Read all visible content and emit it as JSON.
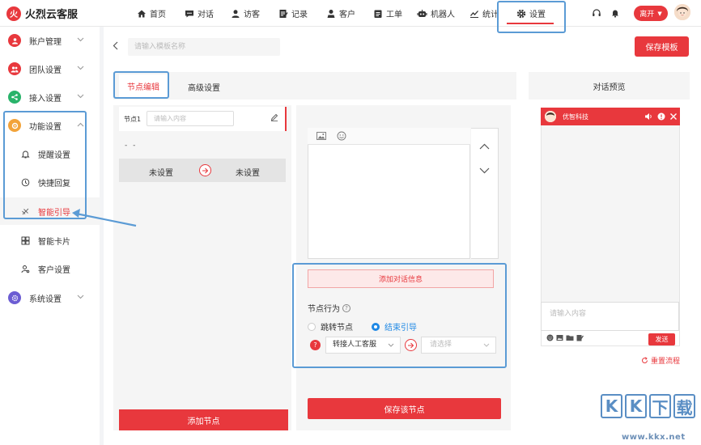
{
  "brand": {
    "logo_text": "火烈云客服",
    "accent": "#e8383d",
    "highlight": "#5b9bd5"
  },
  "topnav": {
    "items": [
      {
        "label": "首页",
        "icon": "home-icon"
      },
      {
        "label": "对话",
        "icon": "chat-icon"
      },
      {
        "label": "访客",
        "icon": "visitor-icon"
      },
      {
        "label": "记录",
        "icon": "record-icon"
      },
      {
        "label": "客户",
        "icon": "customer-icon"
      },
      {
        "label": "工单",
        "icon": "ticket-icon"
      },
      {
        "label": "机器人",
        "icon": "robot-icon"
      },
      {
        "label": "统计",
        "icon": "stats-icon"
      },
      {
        "label": "设置",
        "icon": "gear-icon"
      }
    ],
    "active": "设置",
    "status_label": "离开"
  },
  "sidebar": {
    "groups": [
      {
        "label": "账户管理",
        "icon": "account-icon",
        "color": "#e8383d"
      },
      {
        "label": "团队设置",
        "icon": "team-icon",
        "color": "#e8383d"
      },
      {
        "label": "接入设置",
        "icon": "access-icon",
        "color": "#29b36a"
      },
      {
        "label": "功能设置",
        "icon": "function-icon",
        "color": "#f2a33a"
      },
      {
        "label": "系统设置",
        "icon": "system-icon",
        "color": "#6c5dd3"
      }
    ],
    "sub_items": [
      {
        "label": "提醒设置",
        "icon": "bell-icon"
      },
      {
        "label": "快捷回复",
        "icon": "quick-reply-icon"
      },
      {
        "label": "智能引导",
        "icon": "guide-icon"
      },
      {
        "label": "智能卡片",
        "icon": "card-icon"
      },
      {
        "label": "客户设置",
        "icon": "user-setting-icon"
      }
    ],
    "active_sub": "智能引导"
  },
  "editor": {
    "template_name_placeholder": "请输入模板名称",
    "save_template": "保存模板",
    "tabs": [
      "节点编辑",
      "高级设置"
    ],
    "active_tab": "节点编辑",
    "preview_title": "对话预览",
    "node": {
      "label": "节点1",
      "input_placeholder": "请输入内容",
      "dash": "- -",
      "unset_left": "未设置",
      "unset_right": "未设置"
    },
    "add_node": "添加节点",
    "add_message": "添加对话信息",
    "behavior": {
      "label": "节点行为",
      "options": [
        "跳转节点",
        "结束引导"
      ],
      "selected": "结束引导",
      "transfer_value": "转接人工客服",
      "select_placeholder": "请选择"
    },
    "save_node": "保存该节点"
  },
  "preview": {
    "company": "优智科技",
    "input_placeholder": "请输入内容",
    "send": "发送",
    "reset": "重置流程"
  },
  "watermark": {
    "chars": [
      "K",
      "K",
      "下",
      "载"
    ],
    "url": "www.kkx.net"
  }
}
